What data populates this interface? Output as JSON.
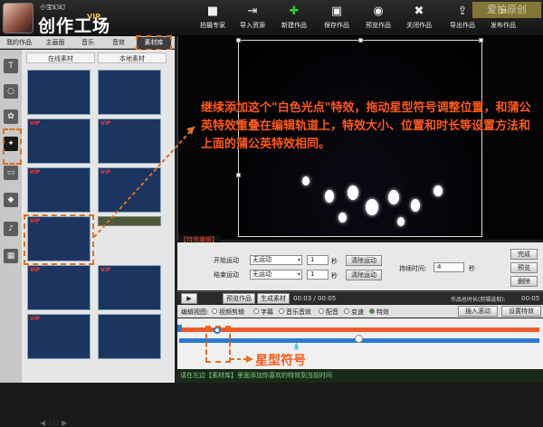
{
  "app": {
    "brand_sub": "小宝幻幻",
    "brand_vip": "VIP",
    "brand_title": "创作工场"
  },
  "toolbar": [
    {
      "icon": "camera-icon",
      "label": "拍摄专家"
    },
    {
      "icon": "import-icon",
      "label": "导入资源"
    },
    {
      "icon": "new-icon",
      "label": "新建作品"
    },
    {
      "icon": "save-icon",
      "label": "保存作品"
    },
    {
      "icon": "eye-icon",
      "label": "预览作品"
    },
    {
      "icon": "close-icon",
      "label": "关闭作品"
    },
    {
      "icon": "export-icon",
      "label": "导出作品"
    },
    {
      "icon": "publish-icon",
      "label": "发布作品"
    }
  ],
  "watermark": "爱拍原创",
  "tabs": [
    "我的作品",
    "主画面",
    "音乐",
    "音效",
    "素材库"
  ],
  "library": {
    "subtabs": [
      "在线素材",
      "本地素材"
    ],
    "vip_badge": "VIP",
    "pager": "1/2"
  },
  "annotation": "继续添加这个\"白色光点\"特效，拖动星型符号调整位置，和蒲公英特效重叠在编辑轨道上，特效大小、位置和时长等设置方法和上面的蒲公英特效相同。",
  "effect_label": "【特效编辑】",
  "edit": {
    "start_label": "开始运动",
    "start_value": "无运动",
    "start_spin": "1",
    "sec": "秒",
    "clear_start": "清除运动",
    "end_label": "结束运动",
    "end_value": "无运动",
    "end_spin": "1",
    "clear_end": "清除运动",
    "duration_label": "持续时间:",
    "duration_value": "4",
    "done": "完成",
    "preview": "预览",
    "delete": "删除"
  },
  "timeline": {
    "play": "▶",
    "preview_work": "预览作品",
    "gen_material": "生成素材",
    "time": "00:03 / 00:05",
    "total_label": "作品总时长(剪辑选取):",
    "total_value": "00:05"
  },
  "modes": {
    "label": "编辑视图:",
    "items": [
      "视频剪辑",
      "字幕",
      "音乐音效",
      "配音",
      "变速",
      "特效"
    ],
    "insert_btn": "插入滚动",
    "settings_btn": "设置特效"
  },
  "star_label": "星型符号",
  "status": "请在左边【素材库】里面添加你喜欢的特效到当前时间"
}
